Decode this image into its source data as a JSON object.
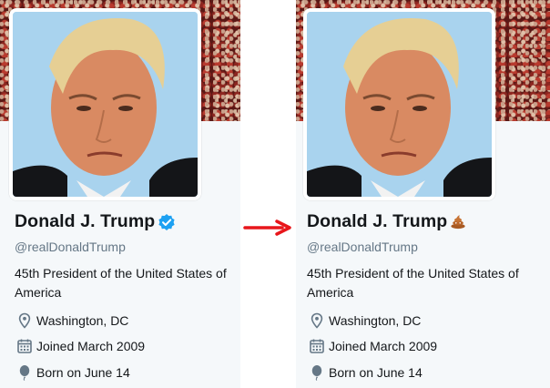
{
  "profile_before": {
    "name": "Donald J. Trump",
    "badge": "verified-badge",
    "handle": "@realDonaldTrump",
    "bio": "45th President of the United States of America",
    "location": "Washington, DC",
    "joined": "Joined March 2009",
    "born": "Born on June 14"
  },
  "profile_after": {
    "name": "Donald J. Trump",
    "badge": "poop-emoji-badge",
    "handle": "@realDonaldTrump",
    "bio": "45th President of the United States of America",
    "location": "Washington, DC",
    "joined": "Joined March 2009",
    "born": "Born on June 14"
  },
  "colors": {
    "verified": "#1da1f2",
    "poop": "#b8652a",
    "arrow": "#e8161b",
    "card_bg": "#f5f8fa",
    "handle_text": "#657786"
  }
}
